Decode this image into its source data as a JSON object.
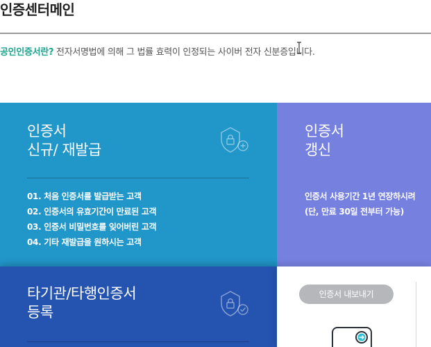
{
  "header": {
    "title": "인증센터메인"
  },
  "intro": {
    "strong": "공인인증서란?",
    "text": " 전자서명법에 의해 그 법률 효력이 인정되는 사이버 전자 신분증입니다."
  },
  "cards": {
    "new": {
      "title_line1": "인증서",
      "title_line2": "신규/ 재발급",
      "icon": "shield-plus-icon",
      "items": [
        "01. 처음 인증서를 발급받는 고객",
        "02. 인증서의 유효기간이 만료된 고객",
        "03. 인증서 비밀번호를 잊어버린 고객",
        "04. 기타 재발급을 원하시는 고객"
      ]
    },
    "renew": {
      "title_line1": "인증서",
      "title_line2": "갱신",
      "text_line1": "인증서 사용기간 1년 연장하시려",
      "text_line2": "(단, 만료 30일 전부터 가능)"
    },
    "other": {
      "title_line1": "타기관/타행인증서",
      "title_line2": "등록",
      "icon": "shield-check-icon"
    },
    "export": {
      "button_label": "인증서 내보내기",
      "icon": "device-export-icon"
    }
  },
  "colors": {
    "new_bg": "#2196c9",
    "renew_bg": "#7680df",
    "other_bg": "#2553b0",
    "accent_text": "#1aa58f"
  }
}
